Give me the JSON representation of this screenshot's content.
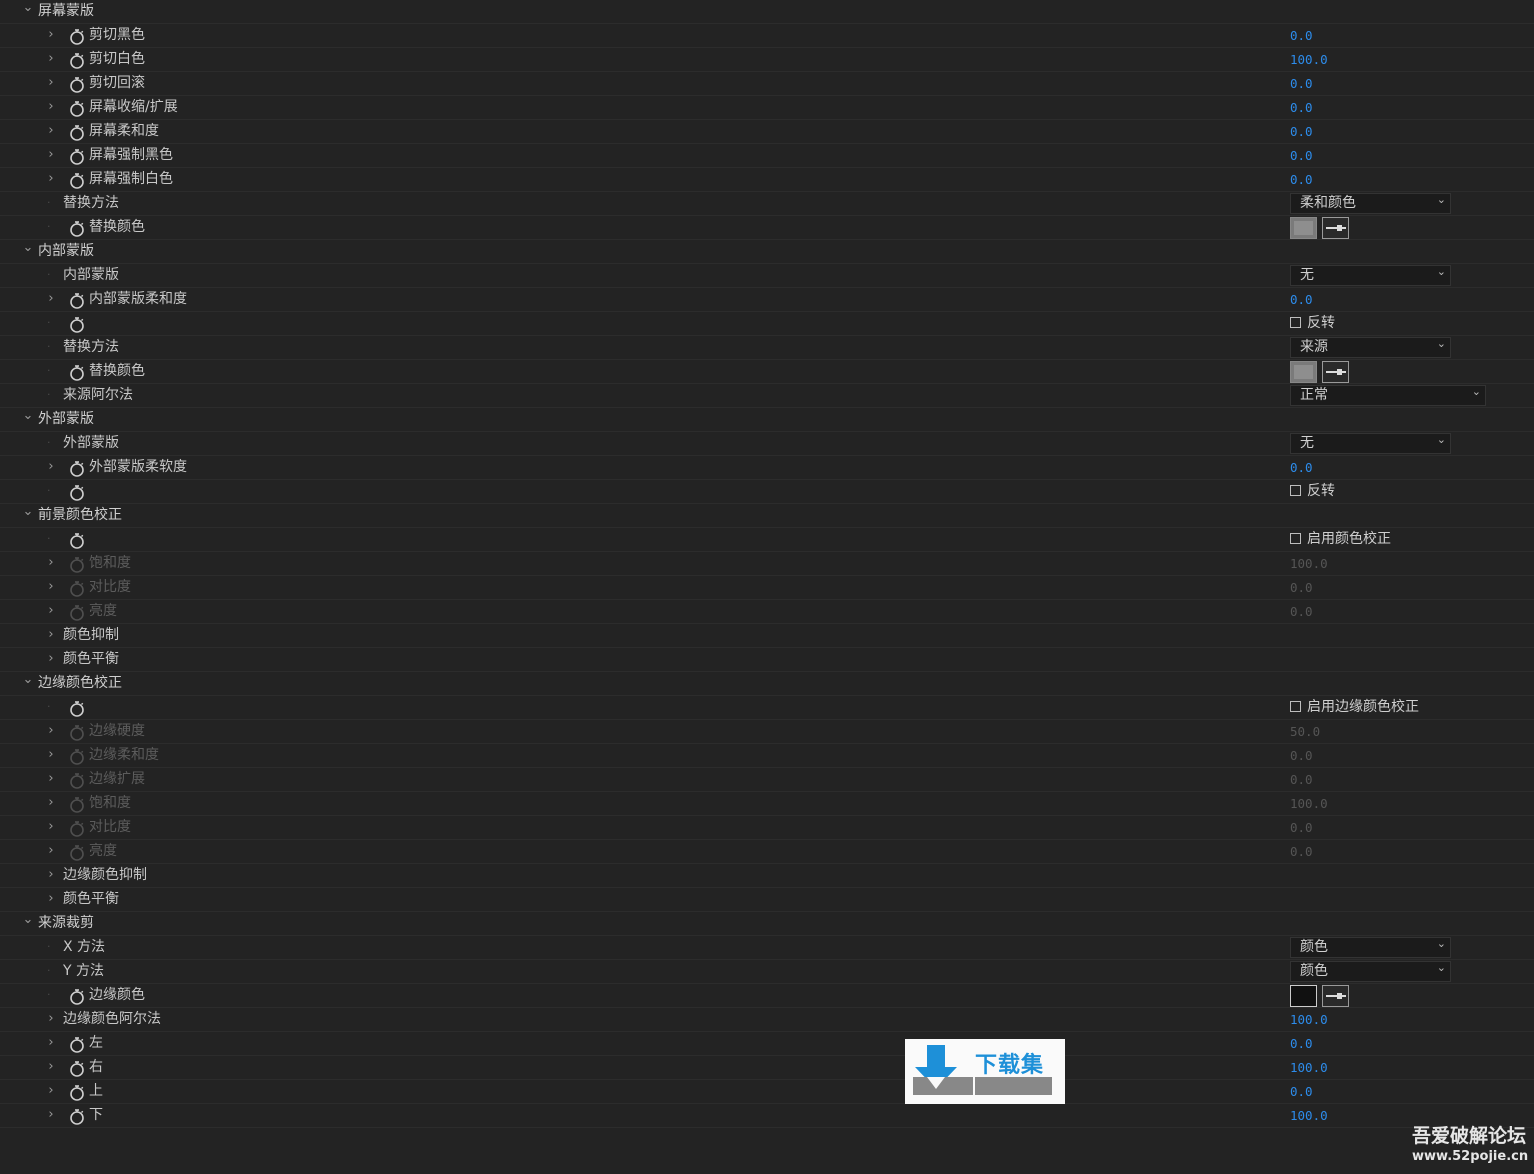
{
  "rows": [
    {
      "kind": "group",
      "label": "屏幕蒙版"
    },
    {
      "kind": "prop",
      "twirl": true,
      "stopwatch": true,
      "label": "剪切黑色",
      "value": "0.0"
    },
    {
      "kind": "prop",
      "twirl": true,
      "stopwatch": true,
      "label": "剪切白色",
      "value": "100.0"
    },
    {
      "kind": "prop",
      "twirl": true,
      "stopwatch": true,
      "label": "剪切回滚",
      "value": "0.0"
    },
    {
      "kind": "prop",
      "twirl": true,
      "stopwatch": true,
      "label": "屏幕收缩/扩展",
      "value": "0.0"
    },
    {
      "kind": "prop",
      "twirl": true,
      "stopwatch": true,
      "label": "屏幕柔和度",
      "value": "0.0"
    },
    {
      "kind": "prop",
      "twirl": true,
      "stopwatch": true,
      "label": "屏幕强制黑色",
      "value": "0.0"
    },
    {
      "kind": "prop",
      "twirl": true,
      "stopwatch": true,
      "label": "屏幕强制白色",
      "value": "0.0"
    },
    {
      "kind": "prop",
      "twirl": false,
      "stopwatch": false,
      "label": "替换方法",
      "dropdown": "柔和颜色"
    },
    {
      "kind": "prop",
      "twirl": false,
      "stopwatch": true,
      "label": "替换颜色",
      "color": "gray"
    },
    {
      "kind": "group",
      "label": "内部蒙版"
    },
    {
      "kind": "prop",
      "twirl": false,
      "stopwatch": false,
      "label": "内部蒙版",
      "dropdown": "无"
    },
    {
      "kind": "prop",
      "twirl": true,
      "stopwatch": true,
      "label": "内部蒙版柔和度",
      "value": "0.0"
    },
    {
      "kind": "prop",
      "twirl": false,
      "stopwatch": true,
      "label": "",
      "checkbox": "反转"
    },
    {
      "kind": "prop",
      "twirl": false,
      "stopwatch": false,
      "label": "替换方法",
      "dropdown": "来源"
    },
    {
      "kind": "prop",
      "twirl": false,
      "stopwatch": true,
      "label": "替换颜色",
      "color": "gray"
    },
    {
      "kind": "prop",
      "twirl": false,
      "stopwatch": false,
      "label": "来源阿尔法",
      "dropdown": "正常",
      "wide": true
    },
    {
      "kind": "group",
      "label": "外部蒙版"
    },
    {
      "kind": "prop",
      "twirl": false,
      "stopwatch": false,
      "label": "外部蒙版",
      "dropdown": "无"
    },
    {
      "kind": "prop",
      "twirl": true,
      "stopwatch": true,
      "label": "外部蒙版柔软度",
      "value": "0.0"
    },
    {
      "kind": "prop",
      "twirl": false,
      "stopwatch": true,
      "label": "",
      "checkbox": "反转"
    },
    {
      "kind": "group",
      "label": "前景颜色校正"
    },
    {
      "kind": "prop",
      "twirl": false,
      "stopwatch": true,
      "label": "",
      "checkbox": "启用颜色校正"
    },
    {
      "kind": "prop",
      "twirl": true,
      "stopwatch": true,
      "disabled": true,
      "label": "饱和度",
      "value": "100.0"
    },
    {
      "kind": "prop",
      "twirl": true,
      "stopwatch": true,
      "disabled": true,
      "label": "对比度",
      "value": "0.0"
    },
    {
      "kind": "prop",
      "twirl": true,
      "stopwatch": true,
      "disabled": true,
      "label": "亮度",
      "value": "0.0"
    },
    {
      "kind": "prop",
      "twirl": true,
      "stopwatch": false,
      "label": "颜色抑制"
    },
    {
      "kind": "prop",
      "twirl": true,
      "stopwatch": false,
      "label": "颜色平衡"
    },
    {
      "kind": "group",
      "label": "边缘颜色校正"
    },
    {
      "kind": "prop",
      "twirl": false,
      "stopwatch": true,
      "label": "",
      "checkbox": "启用边缘颜色校正"
    },
    {
      "kind": "prop",
      "twirl": true,
      "stopwatch": true,
      "disabled": true,
      "label": "边缘硬度",
      "value": "50.0"
    },
    {
      "kind": "prop",
      "twirl": true,
      "stopwatch": true,
      "disabled": true,
      "label": "边缘柔和度",
      "value": "0.0"
    },
    {
      "kind": "prop",
      "twirl": true,
      "stopwatch": true,
      "disabled": true,
      "label": "边缘扩展",
      "value": "0.0"
    },
    {
      "kind": "prop",
      "twirl": true,
      "stopwatch": true,
      "disabled": true,
      "label": "饱和度",
      "value": "100.0"
    },
    {
      "kind": "prop",
      "twirl": true,
      "stopwatch": true,
      "disabled": true,
      "label": "对比度",
      "value": "0.0"
    },
    {
      "kind": "prop",
      "twirl": true,
      "stopwatch": true,
      "disabled": true,
      "label": "亮度",
      "value": "0.0"
    },
    {
      "kind": "prop",
      "twirl": true,
      "stopwatch": false,
      "label": "边缘颜色抑制"
    },
    {
      "kind": "prop",
      "twirl": true,
      "stopwatch": false,
      "label": "颜色平衡"
    },
    {
      "kind": "group",
      "label": "来源裁剪"
    },
    {
      "kind": "prop",
      "twirl": false,
      "stopwatch": false,
      "label": "X 方法",
      "dropdown": "颜色"
    },
    {
      "kind": "prop",
      "twirl": false,
      "stopwatch": false,
      "label": "Y 方法",
      "dropdown": "颜色"
    },
    {
      "kind": "prop",
      "twirl": false,
      "stopwatch": true,
      "label": "边缘颜色",
      "color": "black"
    },
    {
      "kind": "prop",
      "twirl": true,
      "stopwatch": false,
      "label": "边缘颜色阿尔法",
      "value": "100.0"
    },
    {
      "kind": "prop",
      "twirl": true,
      "stopwatch": true,
      "label": "左",
      "value": "0.0"
    },
    {
      "kind": "prop",
      "twirl": true,
      "stopwatch": true,
      "label": "右",
      "value": "100.0"
    },
    {
      "kind": "prop",
      "twirl": true,
      "stopwatch": true,
      "label": "上",
      "value": "0.0"
    },
    {
      "kind": "prop",
      "twirl": true,
      "stopwatch": true,
      "label": "下",
      "value": "100.0"
    }
  ],
  "colors": {
    "value_blue": "#2d8ceb",
    "background": "#232323"
  },
  "logo": {
    "text": "下载集"
  },
  "watermark": {
    "name": "吾爱破解论坛",
    "url": "www.52pojie.cn"
  }
}
